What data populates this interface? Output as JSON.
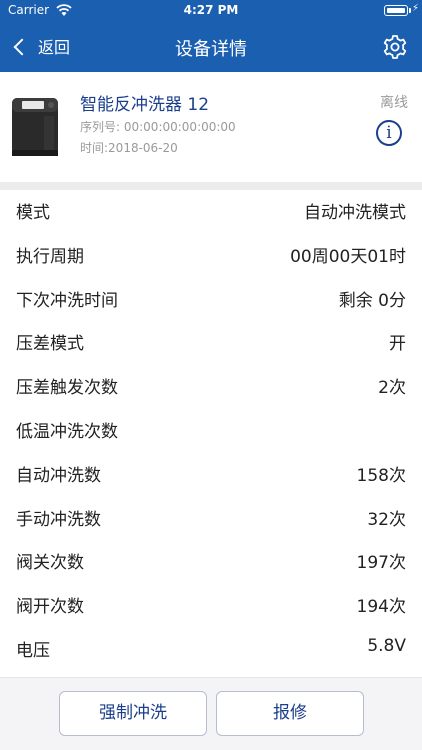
{
  "status_bar": {
    "carrier": "Carrier",
    "time": "4:27 PM"
  },
  "nav": {
    "back_label": "返回",
    "title": "设备详情"
  },
  "device": {
    "name": "智能反冲洗器 12",
    "serial": "序列号: 00:00:00:00:00:00",
    "time": "时间:2018-06-20",
    "status": "离线"
  },
  "rows": [
    {
      "label": "模式",
      "value": "自动冲洗模式"
    },
    {
      "label": "执行周期",
      "value": "00周00天01时"
    },
    {
      "label": "下次冲洗时间",
      "value": "剩余 0分"
    },
    {
      "label": "压差模式",
      "value": "开"
    },
    {
      "label": "压差触发次数",
      "value": "2次"
    },
    {
      "label": "低温冲洗次数",
      "value": ""
    },
    {
      "label": "自动冲洗数",
      "value": "158次"
    },
    {
      "label": "手动冲洗数",
      "value": "32次"
    },
    {
      "label": "阀关次数",
      "value": "197次"
    },
    {
      "label": "阀开次数",
      "value": "194次"
    },
    {
      "label": "电压",
      "value": "5.8V"
    }
  ],
  "actions": {
    "flush_label": "强制冲洗",
    "repair_label": "报修"
  },
  "colors": {
    "header": "#1b5fb0",
    "accent": "#1b3f8c"
  }
}
